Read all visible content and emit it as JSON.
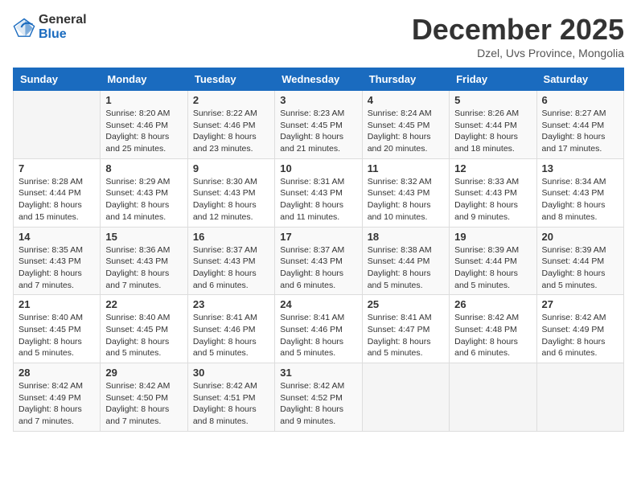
{
  "header": {
    "logo_general": "General",
    "logo_blue": "Blue",
    "month_title": "December 2025",
    "location": "Dzel, Uvs Province, Mongolia"
  },
  "days_of_week": [
    "Sunday",
    "Monday",
    "Tuesday",
    "Wednesday",
    "Thursday",
    "Friday",
    "Saturday"
  ],
  "weeks": [
    [
      {
        "day": "",
        "info": ""
      },
      {
        "day": "1",
        "info": "Sunrise: 8:20 AM\nSunset: 4:46 PM\nDaylight: 8 hours\nand 25 minutes."
      },
      {
        "day": "2",
        "info": "Sunrise: 8:22 AM\nSunset: 4:46 PM\nDaylight: 8 hours\nand 23 minutes."
      },
      {
        "day": "3",
        "info": "Sunrise: 8:23 AM\nSunset: 4:45 PM\nDaylight: 8 hours\nand 21 minutes."
      },
      {
        "day": "4",
        "info": "Sunrise: 8:24 AM\nSunset: 4:45 PM\nDaylight: 8 hours\nand 20 minutes."
      },
      {
        "day": "5",
        "info": "Sunrise: 8:26 AM\nSunset: 4:44 PM\nDaylight: 8 hours\nand 18 minutes."
      },
      {
        "day": "6",
        "info": "Sunrise: 8:27 AM\nSunset: 4:44 PM\nDaylight: 8 hours\nand 17 minutes."
      }
    ],
    [
      {
        "day": "7",
        "info": "Sunrise: 8:28 AM\nSunset: 4:44 PM\nDaylight: 8 hours\nand 15 minutes."
      },
      {
        "day": "8",
        "info": "Sunrise: 8:29 AM\nSunset: 4:43 PM\nDaylight: 8 hours\nand 14 minutes."
      },
      {
        "day": "9",
        "info": "Sunrise: 8:30 AM\nSunset: 4:43 PM\nDaylight: 8 hours\nand 12 minutes."
      },
      {
        "day": "10",
        "info": "Sunrise: 8:31 AM\nSunset: 4:43 PM\nDaylight: 8 hours\nand 11 minutes."
      },
      {
        "day": "11",
        "info": "Sunrise: 8:32 AM\nSunset: 4:43 PM\nDaylight: 8 hours\nand 10 minutes."
      },
      {
        "day": "12",
        "info": "Sunrise: 8:33 AM\nSunset: 4:43 PM\nDaylight: 8 hours\nand 9 minutes."
      },
      {
        "day": "13",
        "info": "Sunrise: 8:34 AM\nSunset: 4:43 PM\nDaylight: 8 hours\nand 8 minutes."
      }
    ],
    [
      {
        "day": "14",
        "info": "Sunrise: 8:35 AM\nSunset: 4:43 PM\nDaylight: 8 hours\nand 7 minutes."
      },
      {
        "day": "15",
        "info": "Sunrise: 8:36 AM\nSunset: 4:43 PM\nDaylight: 8 hours\nand 7 minutes."
      },
      {
        "day": "16",
        "info": "Sunrise: 8:37 AM\nSunset: 4:43 PM\nDaylight: 8 hours\nand 6 minutes."
      },
      {
        "day": "17",
        "info": "Sunrise: 8:37 AM\nSunset: 4:43 PM\nDaylight: 8 hours\nand 6 minutes."
      },
      {
        "day": "18",
        "info": "Sunrise: 8:38 AM\nSunset: 4:44 PM\nDaylight: 8 hours\nand 5 minutes."
      },
      {
        "day": "19",
        "info": "Sunrise: 8:39 AM\nSunset: 4:44 PM\nDaylight: 8 hours\nand 5 minutes."
      },
      {
        "day": "20",
        "info": "Sunrise: 8:39 AM\nSunset: 4:44 PM\nDaylight: 8 hours\nand 5 minutes."
      }
    ],
    [
      {
        "day": "21",
        "info": "Sunrise: 8:40 AM\nSunset: 4:45 PM\nDaylight: 8 hours\nand 5 minutes."
      },
      {
        "day": "22",
        "info": "Sunrise: 8:40 AM\nSunset: 4:45 PM\nDaylight: 8 hours\nand 5 minutes."
      },
      {
        "day": "23",
        "info": "Sunrise: 8:41 AM\nSunset: 4:46 PM\nDaylight: 8 hours\nand 5 minutes."
      },
      {
        "day": "24",
        "info": "Sunrise: 8:41 AM\nSunset: 4:46 PM\nDaylight: 8 hours\nand 5 minutes."
      },
      {
        "day": "25",
        "info": "Sunrise: 8:41 AM\nSunset: 4:47 PM\nDaylight: 8 hours\nand 5 minutes."
      },
      {
        "day": "26",
        "info": "Sunrise: 8:42 AM\nSunset: 4:48 PM\nDaylight: 8 hours\nand 6 minutes."
      },
      {
        "day": "27",
        "info": "Sunrise: 8:42 AM\nSunset: 4:49 PM\nDaylight: 8 hours\nand 6 minutes."
      }
    ],
    [
      {
        "day": "28",
        "info": "Sunrise: 8:42 AM\nSunset: 4:49 PM\nDaylight: 8 hours\nand 7 minutes."
      },
      {
        "day": "29",
        "info": "Sunrise: 8:42 AM\nSunset: 4:50 PM\nDaylight: 8 hours\nand 7 minutes."
      },
      {
        "day": "30",
        "info": "Sunrise: 8:42 AM\nSunset: 4:51 PM\nDaylight: 8 hours\nand 8 minutes."
      },
      {
        "day": "31",
        "info": "Sunrise: 8:42 AM\nSunset: 4:52 PM\nDaylight: 8 hours\nand 9 minutes."
      },
      {
        "day": "",
        "info": ""
      },
      {
        "day": "",
        "info": ""
      },
      {
        "day": "",
        "info": ""
      }
    ]
  ]
}
